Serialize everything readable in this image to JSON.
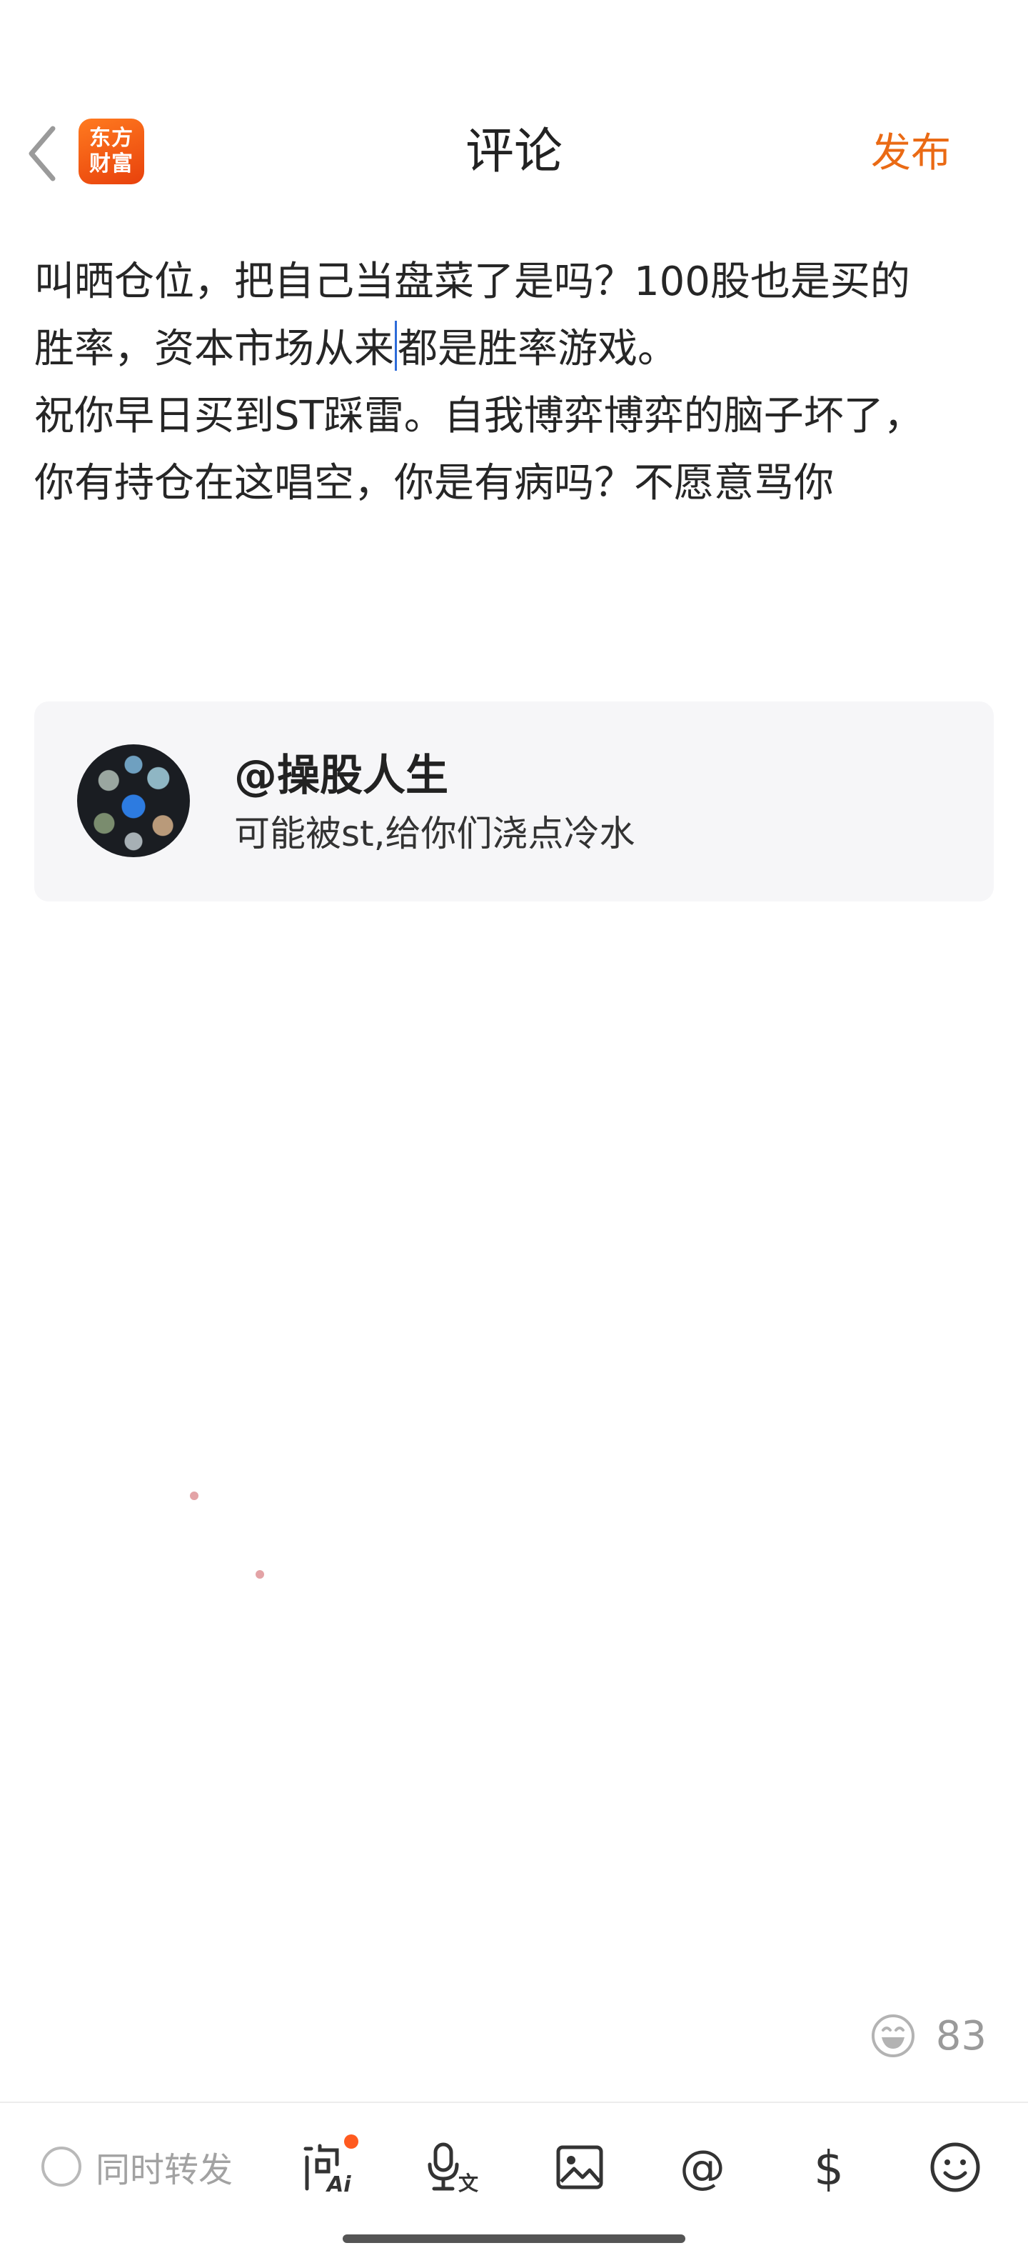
{
  "header": {
    "title": "评论",
    "publish_label": "发布",
    "logo_line1": "东方",
    "logo_line2": "财富"
  },
  "editor": {
    "line1": "叫晒仓位，把自己当盘菜了是吗？100股也是买的",
    "line2a": "胜率，资本市场从来",
    "line2b": "都是胜率游戏。",
    "line3": "祝你早日买到ST踩雷。自我博弈博弈的脑子坏了，",
    "line4": "你有持仓在这唱空，你是有病吗？不愿意骂你"
  },
  "quote_card": {
    "user": "@操股人生",
    "text": "可能被st,给你们浇点冷水"
  },
  "emoji_counter": {
    "count": "83"
  },
  "toolbar": {
    "repost_label": "同时转发",
    "icons": [
      "ask-ai-icon",
      "voice-to-text-icon",
      "image-icon",
      "mention-icon",
      "stock-dollar-icon",
      "emoji-icon"
    ]
  },
  "colors": {
    "accent": "#ea6a14",
    "logo": "#e8410c",
    "caret": "#2d6bd9"
  }
}
